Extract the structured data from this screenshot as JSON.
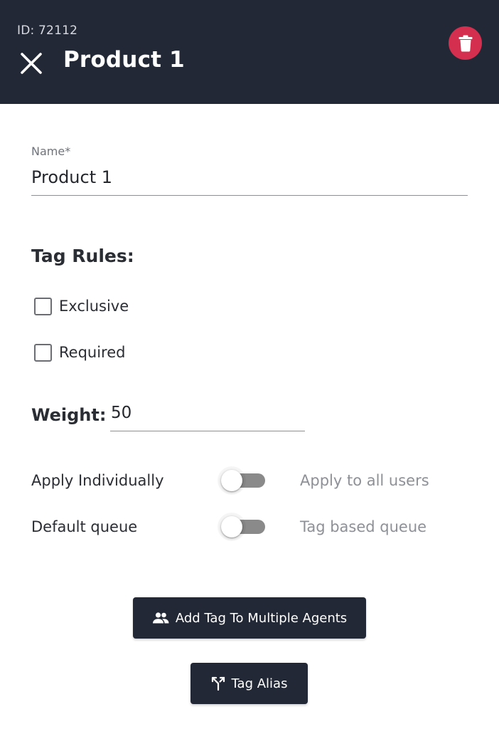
{
  "header": {
    "id_label": "ID: 72112",
    "title": "Product 1",
    "close_icon": "close-icon",
    "delete_icon": "trash-icon",
    "background_color": "#232836",
    "delete_color": "#d42f4e"
  },
  "form": {
    "name": {
      "label": "Name*",
      "value": "Product 1"
    },
    "tag_rules": {
      "title": "Tag Rules:",
      "options": [
        {
          "label": "Exclusive",
          "checked": false
        },
        {
          "label": "Required",
          "checked": false
        }
      ]
    },
    "weight": {
      "label": "Weight:",
      "value": "50"
    },
    "toggles": [
      {
        "left_label": "Apply Individually",
        "right_label": "Apply to all users",
        "on": false
      },
      {
        "left_label": "Default queue",
        "right_label": "Tag based queue",
        "on": false
      }
    ]
  },
  "actions": {
    "add_tag_multiple": {
      "label": "Add Tag To Multiple Agents",
      "icon": "group-icon"
    },
    "tag_alias": {
      "label": "Tag Alias",
      "icon": "merge-icon"
    }
  }
}
